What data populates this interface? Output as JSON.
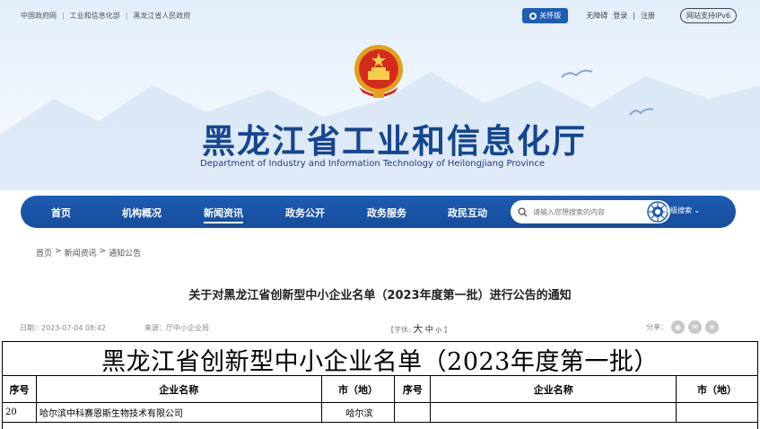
{
  "top_links": [
    "中国政府网",
    "工业和信息化部",
    "黑龙江省人民政府"
  ],
  "top_right": {
    "care_label": "关怀版",
    "accessibility": "无障碍",
    "login": "登录",
    "register": "注册",
    "ipv6": "网站支持IPv6"
  },
  "site": {
    "title": "黑龙江省工业和信息化厅",
    "subtitle": "Department of Industry and Information Technology of Heilongjiang Province"
  },
  "nav": {
    "items": [
      "首页",
      "机构概况",
      "新闻资讯",
      "政务公开",
      "政务服务",
      "政民互动"
    ],
    "active_index": 2,
    "search_placeholder": "请输入您想搜索的内容",
    "advanced_search": "高级搜索 ⌄"
  },
  "breadcrumb": [
    "首页",
    "新闻资讯",
    "通知公告"
  ],
  "article": {
    "title": "关于对黑龙江省创新型中小企业名单（2023年度第一批）进行公告的通知",
    "date": "日期：2023-07-04 08:42",
    "source": "来源：厅中小企业局",
    "font_label": "【字体:",
    "font_big": "大",
    "font_mid": "中",
    "font_small": "小",
    "font_end": "】",
    "share_label": "分享："
  },
  "document": {
    "title": "黑龙江省创新型中小企业名单（2023年度第一批）",
    "headers": [
      "序号",
      "企业名称",
      "市（地）",
      "序号",
      "企业名称",
      "市（地）"
    ],
    "rows": [
      [
        "20",
        "哈尔滨中科赛恩斯生物技术有限公司",
        "哈尔滨",
        "",
        "",
        ""
      ]
    ]
  },
  "colors": {
    "primary": "#1d5cb3",
    "title_blue": "#16468f"
  }
}
